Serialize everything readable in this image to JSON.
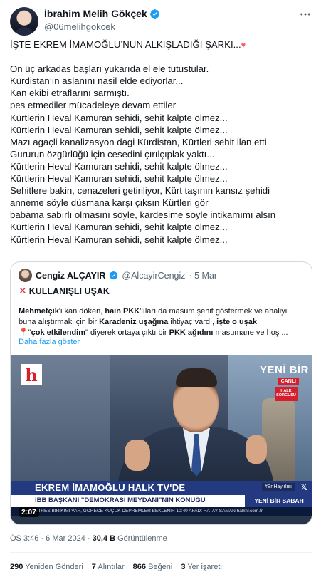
{
  "author": {
    "name": "İbrahim Melih Gökçek",
    "handle": "@06melihgokcek"
  },
  "tweet": {
    "headline": "İŞTE EKREM İMAMOĞLU’NUN ALKIŞLADIĞI ŞARKI...",
    "lines": [
      "On üç arkadas başları yukarıda el ele tutustular.",
      "Kürdistan’ın aslanını nasil elde ediyorlar...",
      "Kan ekibi etraflarını sarmıştı.",
      "pes etmediler mücadeleye devam ettiler",
      "Kürtlerin Heval Kamuran sehidi, sehit kalpte ölmez...",
      "Kürtlerin Heval Kamuran sehidi, sehit kalpte ölmez...",
      "Mazı agaçli kanalizasyon dagi Kürdistan, Kürtleri sehit ilan etti",
      "Gururun özgürlüğü için cesedini çırılçıplak yaktı...",
      "Kürtlerin Heval Kamuran sehidi, sehit kalpte ölmez...",
      "Kürtlerin Heval Kamuran sehidi, sehit kalpte ölmez...",
      "Sehitlere bakin, cenazeleri getiriliyor, Kürt taşının kansız şehidi",
      "anneme söyle düsmana karşı çıksın Kürtleri gör",
      "babama sabırlı olmasını söyle, kardesime söyle intikamımı alsın",
      "Kürtlerin Heval Kamuran sehidi, sehit kalpte ölmez...",
      "Kürtlerin Heval Kamuran sehidi, sehit kalpte ölmez..."
    ]
  },
  "quote": {
    "name": "Cengiz ALÇAYIR",
    "handle": "@AlcayirCengiz",
    "date": "· 5 Mar",
    "title": "KULLANIŞLI UŞAK",
    "text_lines": [
      "Mehmetçik'i kan döken, hain PKK'lıları da masum şehit göstermek ve ahaliyi",
      "buna alıştırmak için bir Karadeniz uşağına ihtiyaç vardı, işte o uşak",
      "\"çok etkilendim\" diyerek ortaya çıktı bir PKK ağıdını masumane ve hoş ..."
    ],
    "show_more": "Daha fazla göster",
    "video": {
      "channel_logo": "h",
      "brand": "YENİ BİR",
      "live": "CANLI",
      "badge": "HALK SORGUSU",
      "lower_title": "EKREM İMAMOĞLU HALK TV'DE",
      "hashtag": "#EnHayırlısı",
      "sub_title": "İBB BAŞKANI \"DEMOKRASİ MEYDANI\"NIN KONUĞU",
      "show_name": "YENİ BİR SABAH",
      "ticker": "STRES BIRIKIMI VAR, GORECE KUÇUK DEPREMLER BEKLENIR  10:40  AFAD: HATAY SAMAN  halktv.com.tr",
      "duration": "2:07"
    }
  },
  "meta": {
    "time": "ÖS 3:46",
    "date": "6 Mar 2024",
    "views": "30,4 B",
    "views_label": "Görüntülenme"
  },
  "stats": {
    "retweets": "290",
    "retweets_label": "Yeniden Gönderi",
    "quotes": "7",
    "quotes_label": "Alıntılar",
    "likes": "866",
    "likes_label": "Beğeni",
    "bookmarks": "3",
    "bookmarks_label": "Yer işareti"
  },
  "colors": {
    "link": "#1d9bf0",
    "verified": "#1d9bf0",
    "heart": "#f4627a"
  }
}
